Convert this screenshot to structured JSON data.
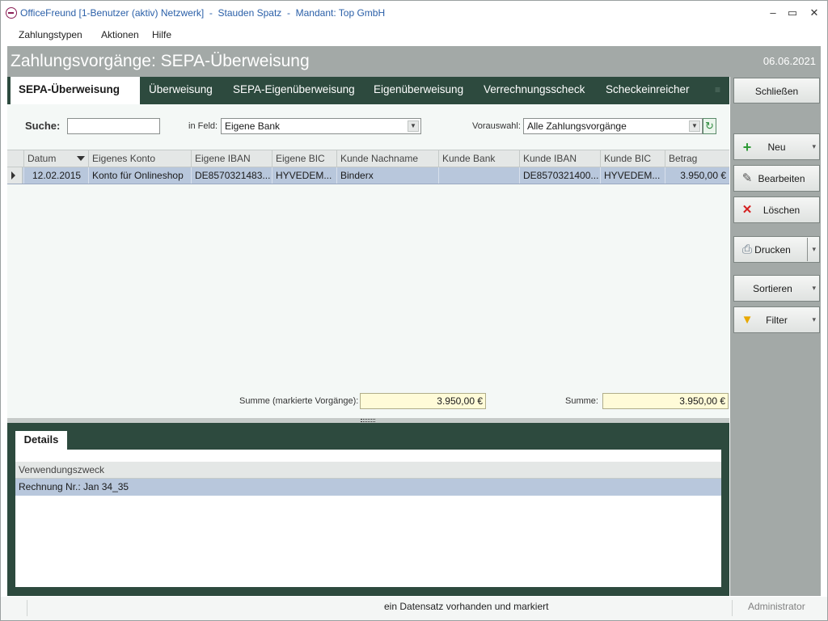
{
  "window": {
    "app_name": "OfficeFreund [1-Benutzer (aktiv) Netzwerk]",
    "user": "Stauden Spatz",
    "mandant": "Mandant: Top GmbH",
    "separator": "-",
    "min_glyph": "–",
    "max_glyph": "▭",
    "close_glyph": "✕"
  },
  "menu": [
    "Zahlungstypen",
    "Aktionen",
    "Hilfe"
  ],
  "header": {
    "title": "Zahlungsvorgänge: SEPA-Überweisung",
    "date": "06.06.2021"
  },
  "tabs": [
    "SEPA-Überweisung",
    "Überweisung",
    "SEPA-Eigenüberweisung",
    "Eigenüberweisung",
    "Verrechnungsscheck",
    "Scheckeinreicher"
  ],
  "filters": {
    "search_label": "Suche:",
    "search_value": "",
    "field_label": "in Feld:",
    "field_value": "Eigene Bank",
    "preselect_label": "Vorauswahl:",
    "preselect_value": "Alle Zahlungsvorgänge"
  },
  "grid": {
    "columns": [
      "Datum",
      "Eigenes Konto",
      "Eigene IBAN",
      "Eigene BIC",
      "Kunde Nachname",
      "Kunde Bank",
      "Kunde IBAN",
      "Kunde BIC",
      "Betrag"
    ],
    "rows": [
      [
        "12.02.2015",
        "Konto für Onlineshop",
        "DE8570321483...",
        "HYVEDEM...",
        "Binderx",
        "",
        "DE8570321400...",
        "HYVEDEM...",
        "3.950,00 €"
      ]
    ]
  },
  "sums": {
    "marked_label": "Summe (markierte Vorgänge):",
    "marked_value": "3.950,00 €",
    "total_label": "Summe:",
    "total_value": "3.950,00 €"
  },
  "details": {
    "tab": "Details",
    "column": "Verwendungszweck",
    "value": "Rechnung Nr.: Jan 34_35"
  },
  "sidebar": {
    "close": "Schließen",
    "new": "Neu",
    "edit": "Bearbeiten",
    "delete": "Löschen",
    "print": "Drucken",
    "sort": "Sortieren",
    "filter": "Filter"
  },
  "status": {
    "message": "ein Datensatz vorhanden und markiert",
    "user": "Administrator"
  },
  "colors": {
    "header_bg": "#a3a9a7",
    "tab_bg": "#2d4a3e",
    "row_selected": "#b8c7dc",
    "sum_bg": "#fffbd8"
  },
  "icons": {
    "new": "plus-icon",
    "edit": "pencil-icon",
    "delete": "red-x-icon",
    "print": "printer-icon",
    "filter": "funnel-icon",
    "refresh": "refresh-icon"
  }
}
